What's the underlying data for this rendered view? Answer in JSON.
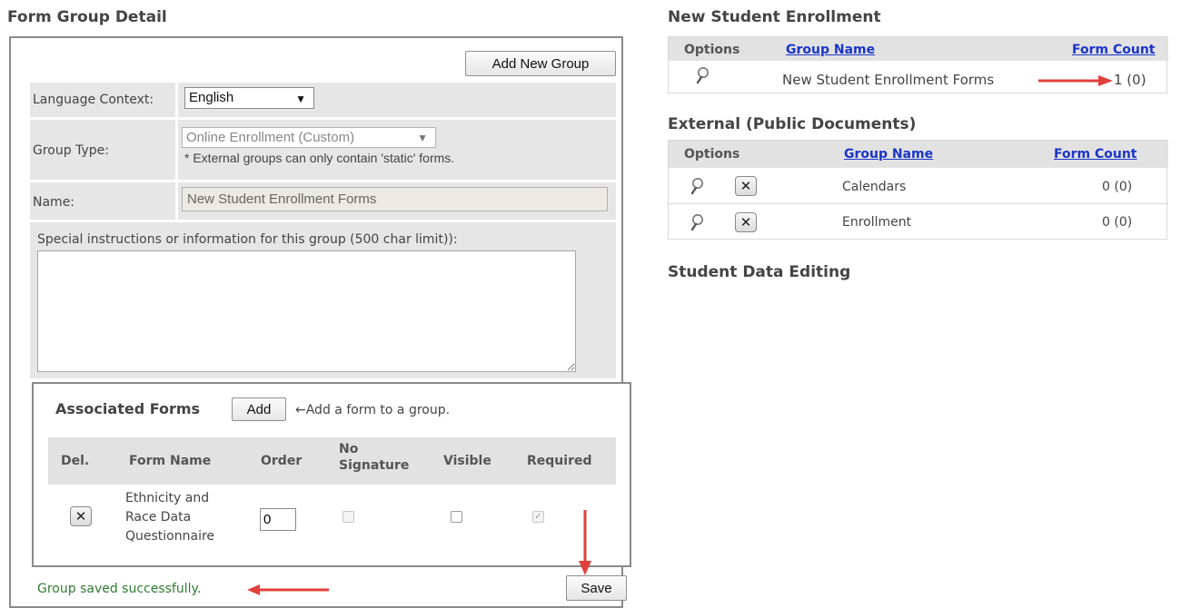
{
  "left": {
    "title": "Form Group Detail",
    "add_new_group_label": "Add New Group",
    "language_context": {
      "label": "Language Context:",
      "value": "English"
    },
    "group_type": {
      "label": "Group Type:",
      "value": "Online Enrollment (Custom)",
      "note": "* External groups can only contain 'static' forms."
    },
    "name": {
      "label": "Name:",
      "value": "New Student Enrollment Forms"
    },
    "instructions_label": "Special instructions or information for this group (500 char limit)):",
    "instructions_value": "",
    "associated_forms": {
      "title": "Associated Forms",
      "add_label": "Add",
      "hint": "←Add a form to a group.",
      "columns": {
        "del": "Del.",
        "form_name": "Form Name",
        "order": "Order",
        "no_signature_1": "No",
        "no_signature_2": "Signature",
        "visible": "Visible",
        "required": "Required"
      },
      "rows": [
        {
          "form_name_lines": [
            "Ethnicity and",
            "Race Data",
            "Questionnaire"
          ],
          "order": "0",
          "no_signature": false,
          "visible": false,
          "required": true
        }
      ]
    },
    "status": "Group saved successfully.",
    "save_label": "Save"
  },
  "right": {
    "sections": [
      {
        "title": "New Student Enrollment",
        "headers": {
          "options": "Options",
          "group_name": "Group Name",
          "form_count": "Form Count"
        },
        "rows": [
          {
            "group_name": "New Student Enrollment Forms",
            "form_count": "1 (0)"
          }
        ]
      },
      {
        "title": "External (Public Documents)",
        "headers": {
          "options": "Options",
          "group_name": "Group Name",
          "form_count": "Form Count"
        },
        "rows": [
          {
            "group_name": "Calendars",
            "form_count": "0 (0)"
          },
          {
            "group_name": "Enrollment",
            "form_count": "0 (0)"
          }
        ]
      },
      {
        "title": "Student Data Editing",
        "rows": []
      }
    ]
  },
  "icons": {
    "magnifier": "magnifier-icon",
    "delete": "delete-x-icon",
    "dropdown": "chevron-down-icon",
    "annotation_arrow": "red-arrow"
  },
  "colors": {
    "link": "#1a35c9",
    "success": "#2e7d32",
    "annotation": "#e0413a",
    "panel_bg": "#e6e6e6"
  }
}
